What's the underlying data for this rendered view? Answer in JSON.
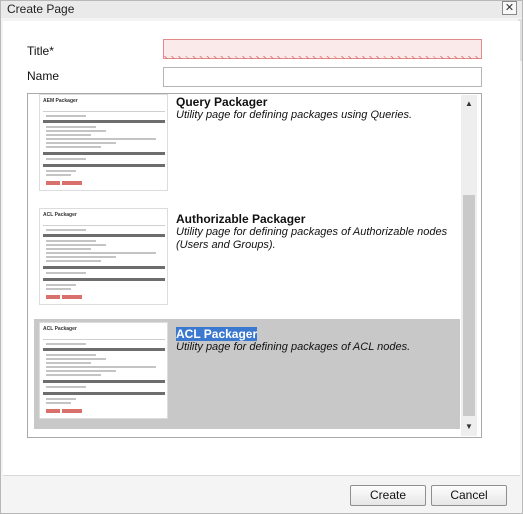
{
  "dialog": {
    "title": "Create Page",
    "close_glyph": "✕"
  },
  "form": {
    "title_label": "Title*",
    "title_value": "",
    "name_label": "Name",
    "name_value": ""
  },
  "templates": [
    {
      "title": "Query Packager",
      "description": "Utility page for defining packages using Queries.",
      "selected": false,
      "thumbnail_heading": "AEM Packager"
    },
    {
      "title": "Authorizable Packager",
      "description": "Utility page for defining packages of Authorizable nodes (Users and Groups).",
      "selected": false,
      "thumbnail_heading": "ACL Packager"
    },
    {
      "title": "ACL Packager",
      "description": "Utility page for defining packages of ACL nodes.",
      "selected": true,
      "thumbnail_heading": "ACL Packager"
    }
  ],
  "scroll": {
    "up_glyph": "▲",
    "down_glyph": "▼"
  },
  "buttons": {
    "create_label": "Create",
    "cancel_label": "Cancel"
  },
  "colors": {
    "selection_bg": "#c8c8c8",
    "highlight": "#3b79d0",
    "error_field": "#fbeaea"
  }
}
